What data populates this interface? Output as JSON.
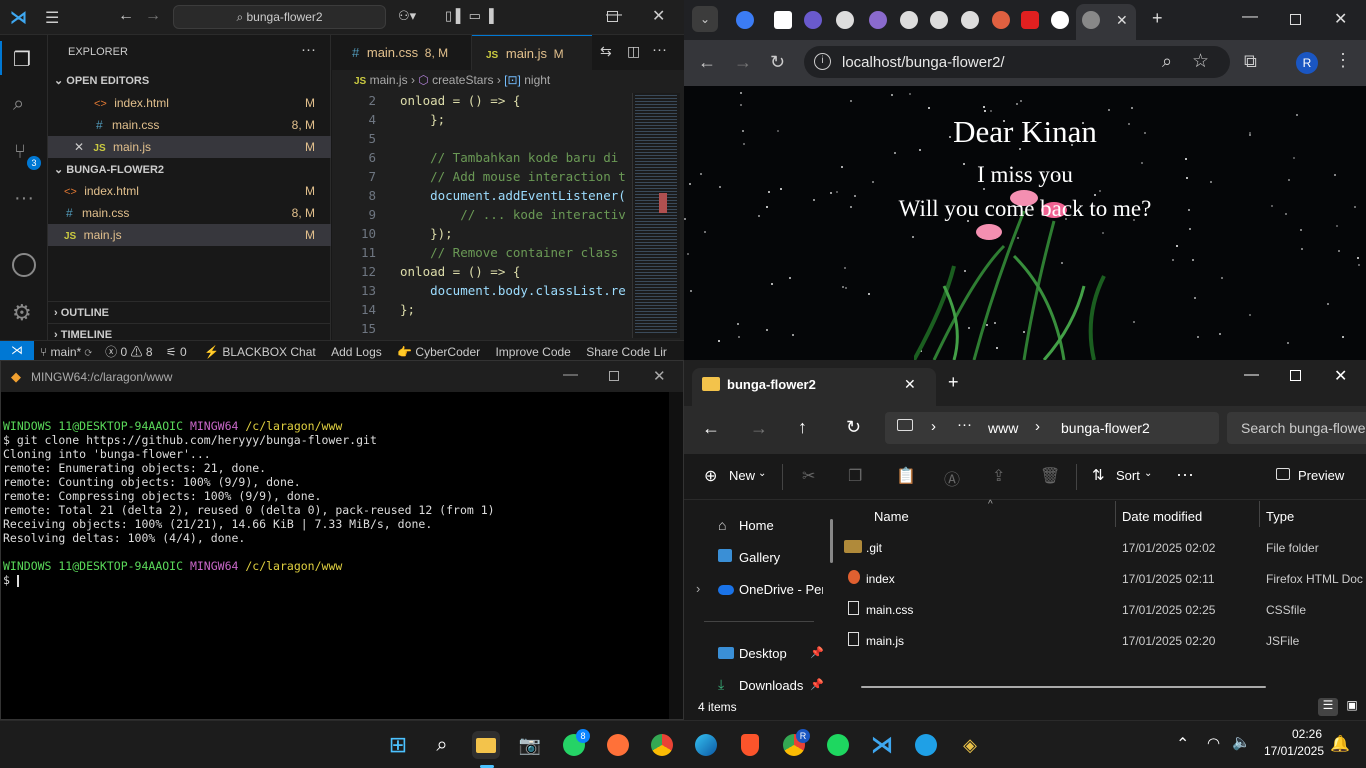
{
  "vscode": {
    "search_text": "bunga-flower2",
    "explorer_title": "EXPLORER",
    "open_editors_label": "OPEN EDITORS",
    "project_label": "BUNGA-FLOWER2",
    "outline_label": "OUTLINE",
    "timeline_label": "TIMELINE",
    "open_editors": [
      {
        "icon": "<>",
        "name": "index.html",
        "mark": "M"
      },
      {
        "icon": "#",
        "name": "main.css",
        "mark": "8, M"
      },
      {
        "icon": "JS",
        "name": "main.js",
        "mark": "M"
      }
    ],
    "files": [
      {
        "icon": "<>",
        "name": "index.html",
        "mark": "M"
      },
      {
        "icon": "#",
        "name": "main.css",
        "mark": "8, M"
      },
      {
        "icon": "JS",
        "name": "main.js",
        "mark": "M"
      }
    ],
    "tabs": [
      {
        "icon": "#",
        "name": "main.css",
        "mark": "8, M"
      },
      {
        "icon": "JS",
        "name": "main.js",
        "mark": "M"
      }
    ],
    "breadcrumb": {
      "file": "main.js",
      "fn": "createStars",
      "var": "night"
    },
    "badge_count": "3",
    "code_lines": [
      {
        "n": "2",
        "t": "onload = () => {"
      },
      {
        "n": "4",
        "t": "    };"
      },
      {
        "n": "5",
        "t": ""
      },
      {
        "n": "6",
        "t": "    // Tambahkan kode baru di"
      },
      {
        "n": "7",
        "t": "    // Add mouse interaction t"
      },
      {
        "n": "8",
        "t": "    document.addEventListener("
      },
      {
        "n": "9",
        "t": "        // ... kode interactiv"
      },
      {
        "n": "10",
        "t": "    });"
      },
      {
        "n": "11",
        "t": "    // Remove container class"
      },
      {
        "n": "12",
        "t": "onload = () => {"
      },
      {
        "n": "13",
        "t": "    document.body.classList.re"
      },
      {
        "n": "14",
        "t": "};"
      },
      {
        "n": "15",
        "t": ""
      }
    ],
    "status": {
      "branch": "main*",
      "errors": "0",
      "warnings": "8",
      "ports": "0",
      "items": [
        "BLACKBOX Chat",
        "Add Logs",
        "CyberCoder",
        "Improve Code",
        "Share Code Lir"
      ]
    }
  },
  "browser": {
    "url": "localhost/bunga-flower2/",
    "profile": "R",
    "page_title": "Dear Kinan",
    "line1": "I miss you",
    "line2": "Will you come back to me?"
  },
  "terminal": {
    "title": "MINGW64:/c/laragon/www",
    "prompt_user": "WINDOWS 11@DESKTOP-94AAOIC",
    "prompt_shell": "MINGW64",
    "prompt_path": "/c/laragon/www",
    "command": "$ git clone https://github.com/heryyy/bunga-flower.git",
    "output": [
      "Cloning into 'bunga-flower'...",
      "remote: Enumerating objects: 21, done.",
      "remote: Counting objects: 100% (9/9), done.",
      "remote: Compressing objects: 100% (9/9), done.",
      "remote: Total 21 (delta 2), reused 0 (delta 0), pack-reused 12 (from 1)",
      "Receiving objects: 100% (21/21), 14.66 KiB | 7.33 MiB/s, done.",
      "Resolving deltas: 100% (4/4), done."
    ],
    "final_prompt": "$"
  },
  "explorer": {
    "tab_title": "bunga-flower2",
    "breadcrumb": [
      "www",
      "bunga-flower2"
    ],
    "search_placeholder": "Search bunga-flowe",
    "new_label": "New",
    "sort_label": "Sort",
    "preview_label": "Preview",
    "nav": [
      "Home",
      "Gallery",
      "OneDrive - Perso",
      "Desktop",
      "Downloads"
    ],
    "columns": [
      "Name",
      "Date modified",
      "Type"
    ],
    "rows": [
      {
        "name": ".git",
        "date": "17/01/2025 02:02",
        "type": "File folder"
      },
      {
        "name": "index",
        "date": "17/01/2025 02:11",
        "type": "Firefox HTML Doc"
      },
      {
        "name": "main.css",
        "date": "17/01/2025 02:25",
        "type": "CSSfile"
      },
      {
        "name": "main.js",
        "date": "17/01/2025 02:20",
        "type": "JSFile"
      }
    ],
    "status": "4 items"
  },
  "taskbar": {
    "time": "02:26",
    "date": "17/01/2025",
    "whatsapp_badge": "8",
    "chrome_badge": "R"
  }
}
